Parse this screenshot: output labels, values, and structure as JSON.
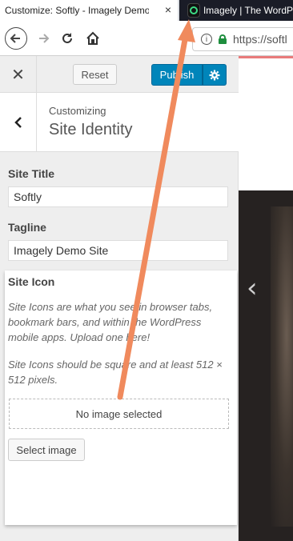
{
  "browser": {
    "active_tab_title": "Customize: Softly - Imagely Demo S",
    "active_tab_close": "×",
    "inactive_tab_title": "Imagely | The WordP",
    "url": "https://softl"
  },
  "panel": {
    "reset_label": "Reset",
    "publish_label": "Publish",
    "breadcrumb": "Customizing",
    "section_title": "Site Identity"
  },
  "fields": {
    "site_title_label": "Site Title",
    "site_title_value": "Softly",
    "tagline_label": "Tagline",
    "tagline_value": "Imagely Demo Site"
  },
  "site_icon": {
    "label": "Site Icon",
    "description_1": "Site Icons are what you see in browser tabs, bookmark bars, and within the WordPress mobile apps. Upload one here!",
    "description_2": "Site Icons should be square and at least 512 × 512 pixels.",
    "placeholder": "No image selected",
    "select_button": "Select image"
  },
  "colors": {
    "publish_blue": "#0085ba",
    "arrow_orange": "#f08a5d",
    "lock_green": "#1e8e3e"
  },
  "icons": [
    "close-icon",
    "back-arrow-icon",
    "forward-arrow-icon",
    "reload-icon",
    "home-icon",
    "info-icon",
    "lock-icon",
    "gear-icon",
    "chevron-left-icon"
  ]
}
